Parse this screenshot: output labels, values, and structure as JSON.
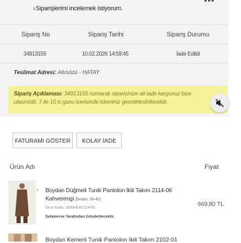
{
  "header": {
    "chat_link": "Siparişlerimi incelemek istiyorum.",
    "menu_dots": "•••"
  },
  "order_table": {
    "columns": [
      "Sipariş No",
      "Sipariş Tarihi",
      "Sipariş Durumu"
    ],
    "row": {
      "order_no": "34913155",
      "order_date": "10.02.2026 14:59:45",
      "status": "İade Edildi"
    }
  },
  "delivery": {
    "label": "Teslimat Adresi:",
    "value": "Altınözü - HATAY"
  },
  "note": {
    "label": "Sipariş Açıklaması:",
    "text": "34913155 numaralı siparişinize ait iade kargonuz bize ulasmistir. 7 ile 10 is gunu icerisinde isleminiz gerceklestirilecektir."
  },
  "actions": {
    "invoice_button": "FATURAMI GÖSTER",
    "return_button": "KOLAY İADE"
  },
  "products_table": {
    "col_product": "Ürün Adı",
    "col_price": "Fiyat",
    "items": [
      {
        "name": "Boydan Düğmeli Tunik Pantolon İkili Takım 2114-06 Kahverengi",
        "size": "[Beden: 38-40]",
        "code": "Ürün Kodu: ZEMHER2114-06",
        "sender": "Sefamerve Tarafından Gönderilecektir.",
        "price": "669.80 TL"
      },
      {
        "name": "Boydan Kemerli Tunik Pantolon İkili Takım 2102-01"
      }
    ]
  },
  "colors": {
    "note_bg": "#f5f29a",
    "note_text": "#8a7e1e",
    "card_bg": "#f4f4f4"
  },
  "icons": {
    "fab": "sound-off-icon",
    "chevron": "chevron-right-icon"
  }
}
